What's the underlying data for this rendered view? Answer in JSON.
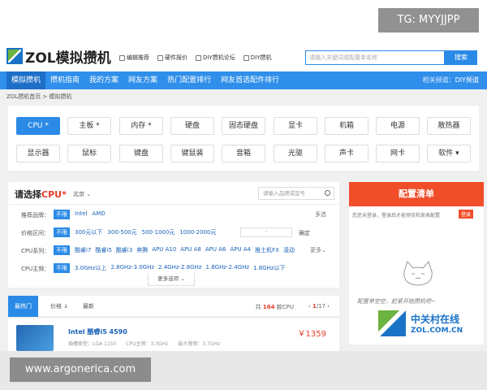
{
  "watermark_top": "TG: MYYJJPP",
  "watermark_bottom": "www.argonerica.com",
  "logo": {
    "text": "ZOL模拟攒机"
  },
  "quicklinks": [
    "编辑推荐",
    "硬件报价",
    "DIY攒机论坛",
    "DIY攒机"
  ],
  "search": {
    "placeholder": "请输入关键词或配置单名称",
    "button": "搜索"
  },
  "nav": {
    "items": [
      "模拟攒机",
      "攒机指南",
      "我的方案",
      "网友方案",
      "热门配置排行",
      "网友首选配件排行"
    ],
    "related_label": "相关频道：",
    "related_link": "DIY频道"
  },
  "breadcrumb": "ZOL攒机首页 > 模拟攒机",
  "categories": {
    "row1": [
      "CPU *",
      "主板 *",
      "内存 *",
      "硬盘",
      "固态硬盘",
      "显卡",
      "机箱",
      "电源",
      "散热器"
    ],
    "row2": [
      "显示器",
      "鼠标",
      "键盘",
      "键鼠装",
      "音箱",
      "光驱",
      "声卡",
      "网卡",
      "软件"
    ]
  },
  "selector": {
    "title_prefix": "请选择",
    "title_highlight": "CPU*",
    "city": "北京",
    "search_placeholder": "请输入品牌或型号",
    "rows": [
      {
        "label": "推荐品牌：",
        "nolimit": "不限",
        "options": [
          "Intel",
          "AMD"
        ],
        "more": "多选"
      },
      {
        "label": "价格区间：",
        "nolimit": "不限",
        "options": [
          "300元以下",
          "300-500元",
          "500-1000元",
          "1000-2000元"
        ],
        "ok": "确定"
      },
      {
        "label": "CPU系列：",
        "nolimit": "不限",
        "options": [
          "酷睿i7",
          "酷睿i5",
          "酷睿i3",
          "奔腾",
          "APU A10",
          "APU A8",
          "APU A6",
          "APU A4",
          "推土机FX",
          "凌动"
        ],
        "more": "更多"
      },
      {
        "label": "CPU主频：",
        "nolimit": "不限",
        "options": [
          "3.0GHz以上",
          "2.8GHz-3.0GHz",
          "2.4GHz-2.8GHz",
          "1.8GHz-2.4GHz",
          "1.8GHz以下"
        ]
      }
    ],
    "more_options": "更多选项"
  },
  "list_tabs": {
    "tabs": [
      "最热门",
      "价格",
      "最新"
    ],
    "total_prefix": "共",
    "total_count": "164",
    "total_suffix": "款CPU",
    "page_current": "1",
    "page_total": "/17"
  },
  "product": {
    "name": "Intel 酷睿i5 4590",
    "price": "￥1359",
    "specs": "插槽类型：LGA 1150　　CPU主频：3.3GHz　　最大睿频：3.7GHz"
  },
  "config": {
    "title": "配置清单",
    "login_tip": "您还未登录，登录后才能预览和发表配置",
    "login_btn": "登录",
    "empty_tip": "配置单空空，赶紧开始攒机吧~",
    "brand_cn": "中关村在线",
    "brand_en": "ZOL.COM.CN"
  }
}
